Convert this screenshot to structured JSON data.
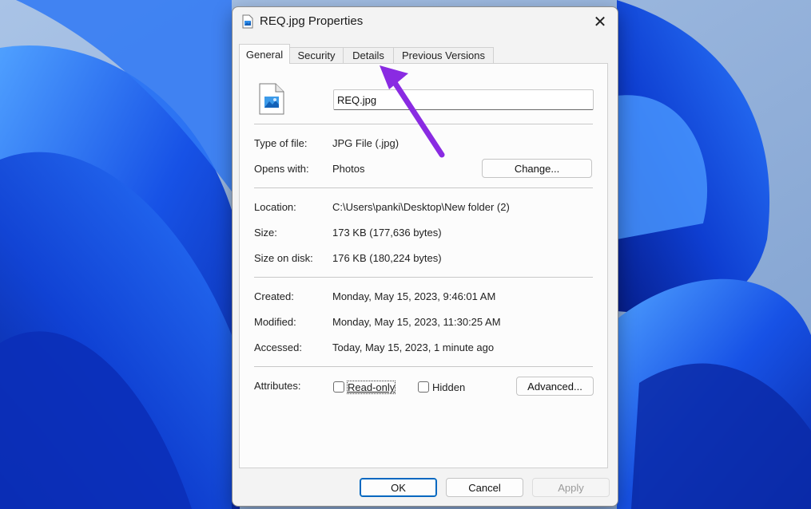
{
  "window": {
    "title": "REQ.jpg Properties",
    "close_icon": "close-icon",
    "file_icon": "image-file-icon"
  },
  "tabs": [
    {
      "label": "General",
      "active": true
    },
    {
      "label": "Security",
      "active": false
    },
    {
      "label": "Details",
      "active": false
    },
    {
      "label": "Previous Versions",
      "active": false
    }
  ],
  "general": {
    "file_name": "REQ.jpg",
    "type_of_file": {
      "label": "Type of file:",
      "value": "JPG File (.jpg)"
    },
    "opens_with": {
      "label": "Opens with:",
      "value": "Photos",
      "button": "Change..."
    },
    "location": {
      "label": "Location:",
      "value": "C:\\Users\\panki\\Desktop\\New folder (2)"
    },
    "size": {
      "label": "Size:",
      "value": "173 KB (177,636 bytes)"
    },
    "size_on_disk": {
      "label": "Size on disk:",
      "value": "176 KB (180,224 bytes)"
    },
    "created": {
      "label": "Created:",
      "value": "Monday, May 15, 2023, 9:46:01 AM"
    },
    "modified": {
      "label": "Modified:",
      "value": "Monday, May 15, 2023, 11:30:25 AM"
    },
    "accessed": {
      "label": "Accessed:",
      "value": "Today, May 15, 2023, 1 minute ago"
    },
    "attributes": {
      "label": "Attributes:",
      "read_only": {
        "label": "Read-only",
        "checked": false
      },
      "hidden": {
        "label": "Hidden",
        "checked": false
      },
      "advanced_button": "Advanced..."
    }
  },
  "footer": {
    "ok": "OK",
    "cancel": "Cancel",
    "apply": "Apply"
  },
  "annotation": {
    "arrow_color": "#8a2be2",
    "points_to": "Details tab"
  },
  "colors": {
    "accent": "#0067c0",
    "wallpaper": "#1a5cf0"
  }
}
